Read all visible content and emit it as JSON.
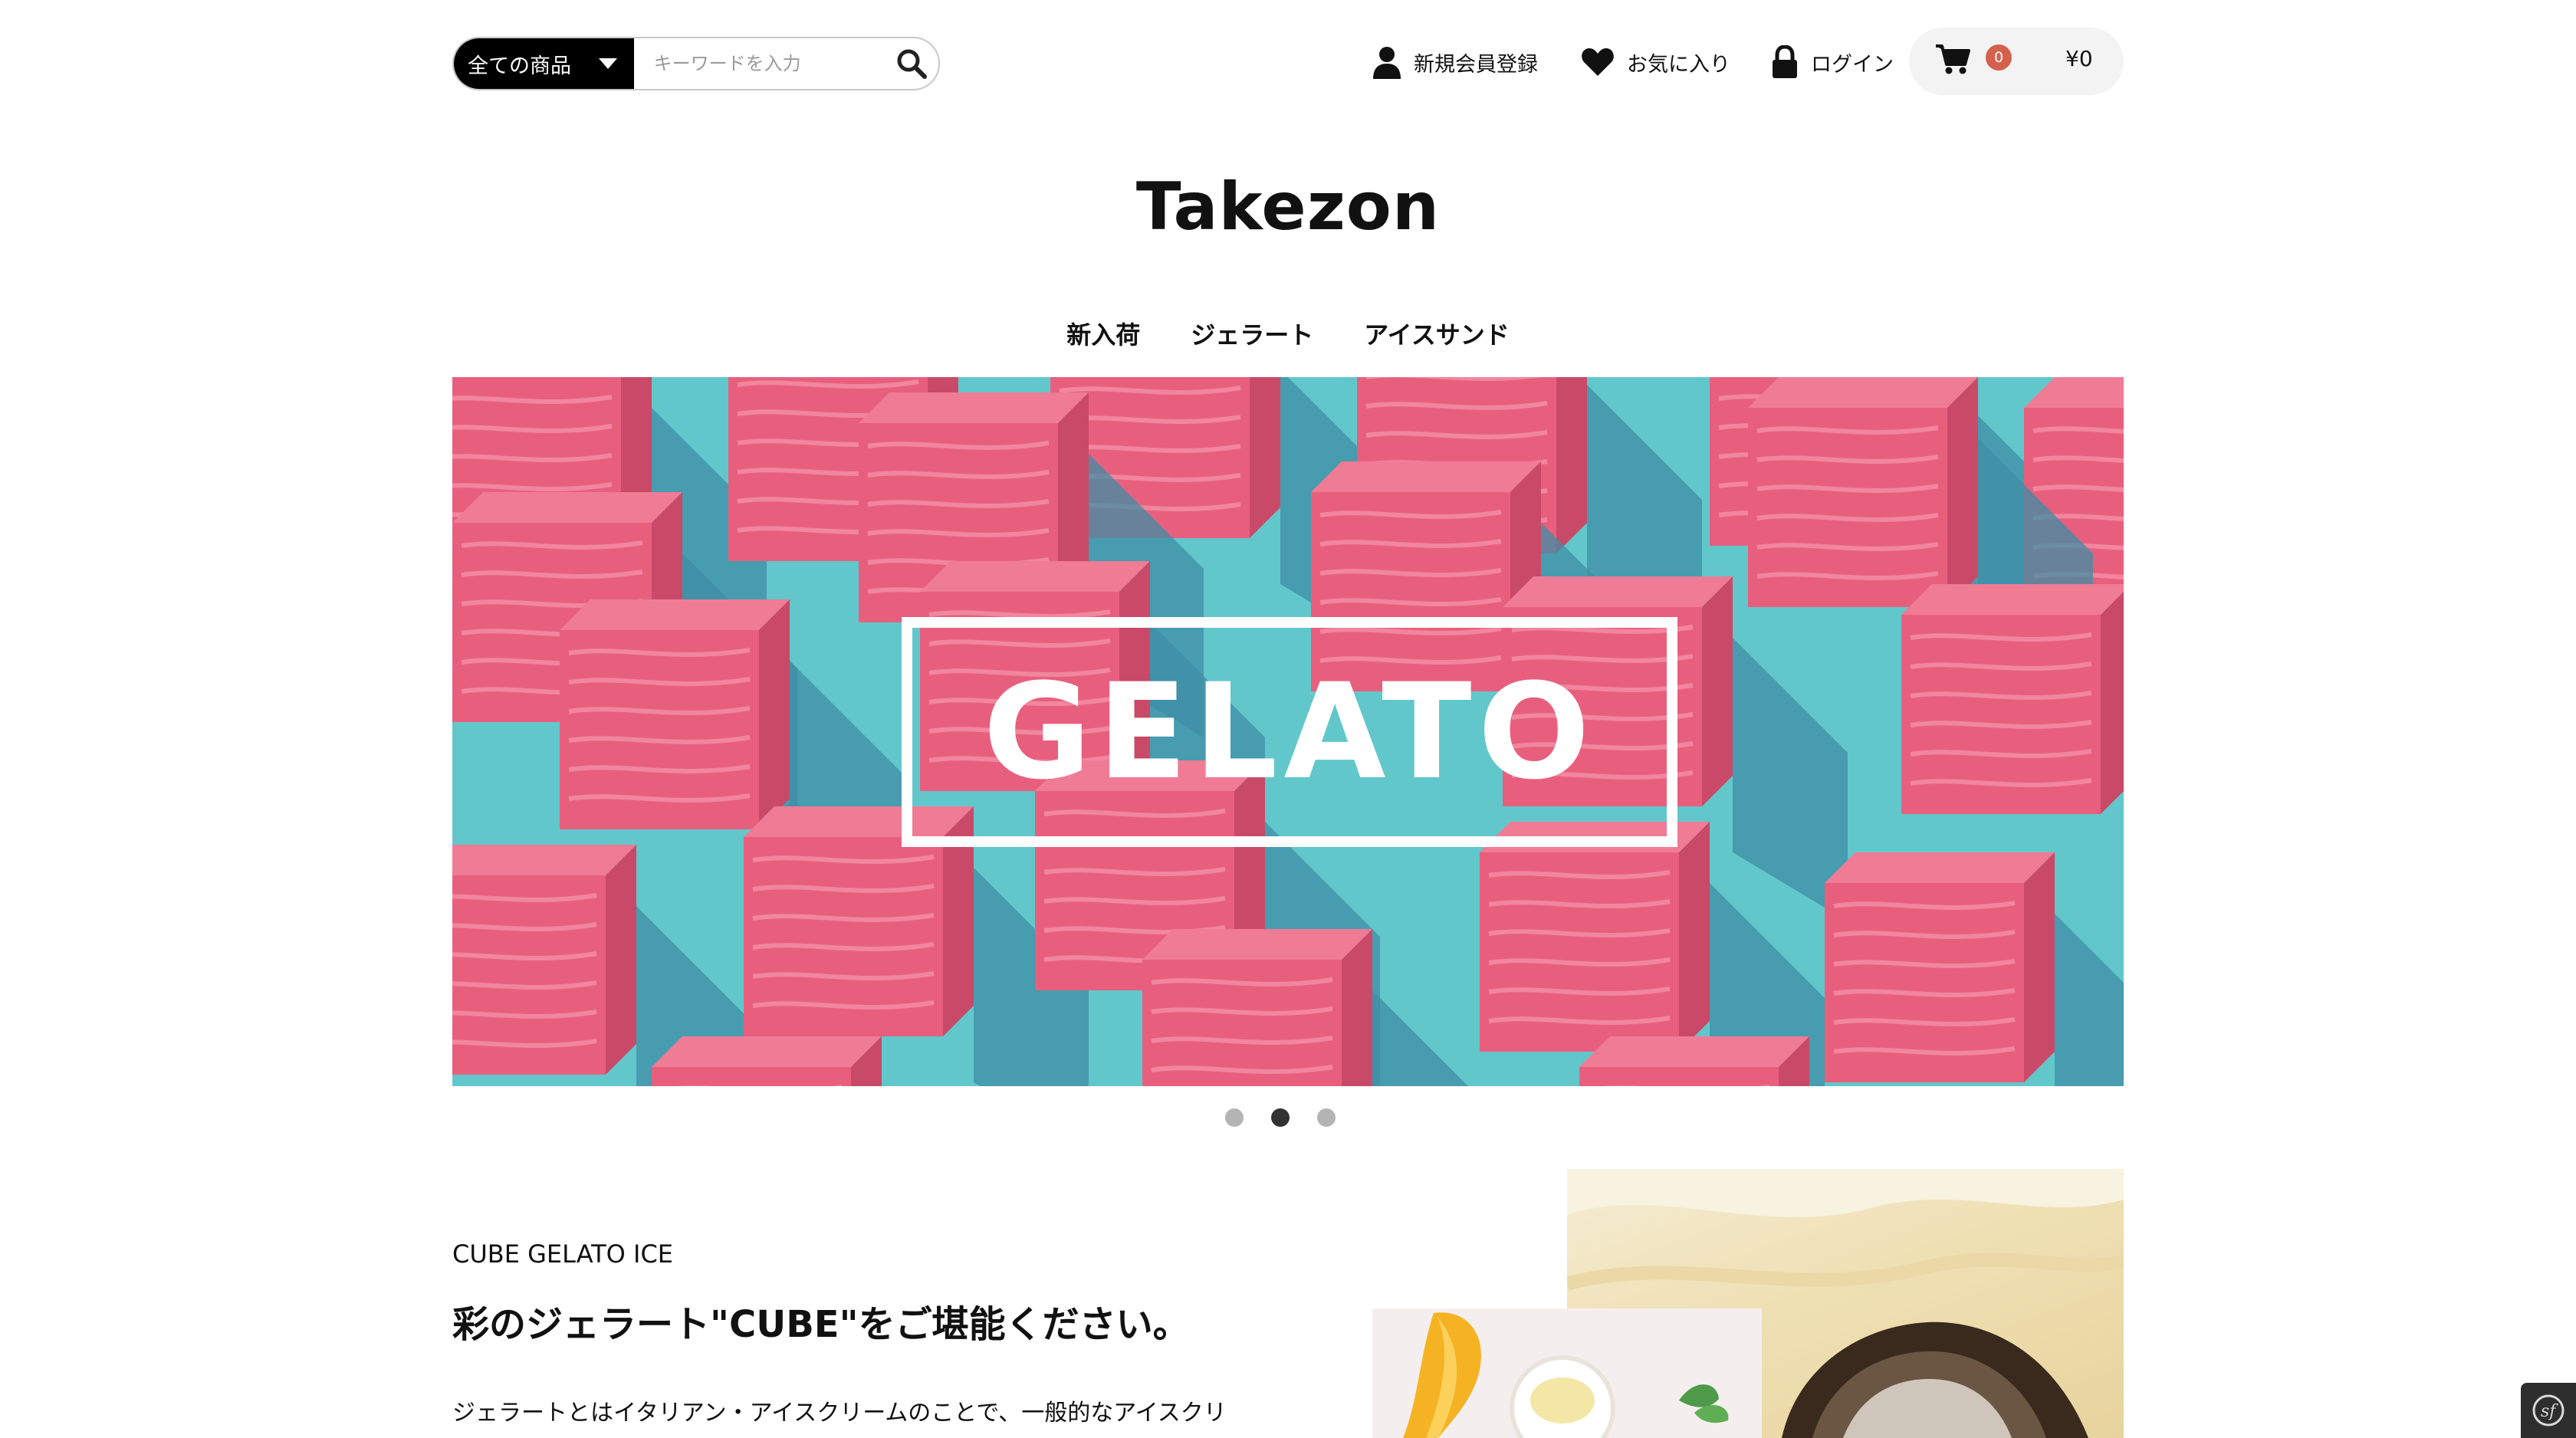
{
  "header": {
    "search": {
      "category_label": "全ての商品",
      "placeholder": "キーワードを入力"
    },
    "nav": {
      "register_label": "新規会員登録",
      "favorites_label": "お気に入り",
      "login_label": "ログイン"
    },
    "cart": {
      "count": "0",
      "total": "¥0"
    }
  },
  "logo": "Takezon",
  "categories": [
    "新入荷",
    "ジェラート",
    "アイスサンド"
  ],
  "hero": {
    "slide_text": "GELATO",
    "slide_count": 3,
    "active_slide": 2
  },
  "feature": {
    "eyebrow": "CUBE GELATO ICE",
    "title": "彩のジェラート\"CUBE\"をご堪能ください。",
    "body": "ジェラートとはイタリアン・アイスクリームのことで、一般的なアイスクリ"
  },
  "colors": {
    "hero_background": "#62c7cb",
    "gelato_pink": "#e85f7e",
    "cart_badge": "#d5604b"
  }
}
